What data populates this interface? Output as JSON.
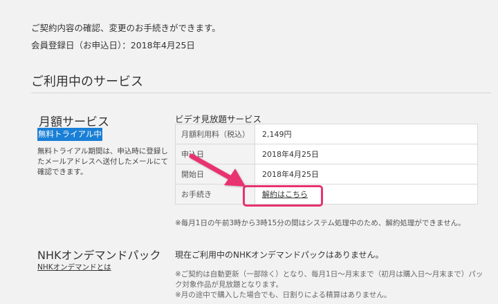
{
  "intro": {
    "line1": "ご契約内容の確認、変更のお手続きができます。",
    "line2": "会員登録日（お申込日）：2018年4月25日"
  },
  "section_title": "ご利用中のサービス",
  "plan": {
    "title": "月額サービス",
    "badge": "無料トライアル中",
    "note": "無料トライアル期間は、申込時に登録したメールアドレスへ送付したメールにて確認できます。"
  },
  "service": {
    "title": "ビデオ見放題サービス",
    "rows": [
      {
        "label": "月額利用料（税込）",
        "value": "2,149円"
      },
      {
        "label": "申込日",
        "value": "2018年4月25日"
      },
      {
        "label": "開始日",
        "value": "2018年4月25日"
      },
      {
        "label": "お手続き",
        "value": "解約はこちら"
      }
    ],
    "note": "※毎月1日の午前3時から3時15分の間はシステム処理中のため、解約処理ができません。"
  },
  "nhk": {
    "title": "NHKオンデマンドパック",
    "link": "NHKオンデマンドとは",
    "status": "現在ご利用中のNHKオンデマンドパックはありません。",
    "note1": "※ご契約は自動更新（一部除く）となり、毎月1日～月末まで（初月は購入日～月末まで）パック対象作品が見放題となります。",
    "note2": "※月の途中で購入した場合でも、日割りによる精算はありません。"
  },
  "colors": {
    "badge": "#1a7fd6",
    "highlight": "#e9316f",
    "arrow": "#e9316f"
  }
}
